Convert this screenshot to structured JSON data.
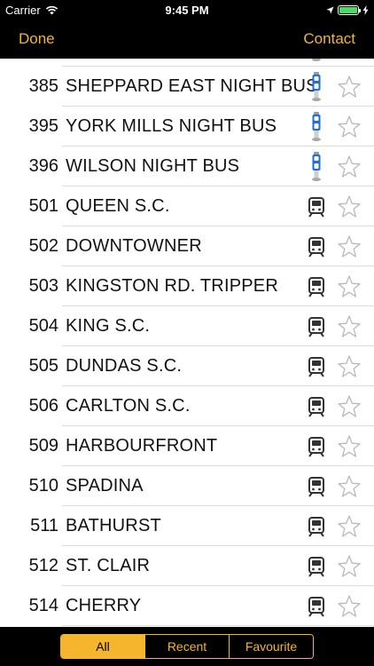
{
  "status_bar": {
    "carrier": "Carrier",
    "time": "9:45 PM"
  },
  "nav": {
    "done_label": "Done",
    "contact_label": "Contact"
  },
  "routes": [
    {
      "number": "",
      "name": "",
      "type": "night"
    },
    {
      "number": "385",
      "name": "SHEPPARD EAST NIGHT BUS",
      "type": "night"
    },
    {
      "number": "395",
      "name": "YORK MILLS NIGHT BUS",
      "type": "night"
    },
    {
      "number": "396",
      "name": "WILSON NIGHT BUS",
      "type": "night"
    },
    {
      "number": "501",
      "name": "QUEEN S.C.",
      "type": "streetcar"
    },
    {
      "number": "502",
      "name": "DOWNTOWNER",
      "type": "streetcar"
    },
    {
      "number": "503",
      "name": "KINGSTON RD. TRIPPER",
      "type": "streetcar"
    },
    {
      "number": "504",
      "name": "KING S.C.",
      "type": "streetcar"
    },
    {
      "number": "505",
      "name": "DUNDAS S.C.",
      "type": "streetcar"
    },
    {
      "number": "506",
      "name": "CARLTON S.C.",
      "type": "streetcar"
    },
    {
      "number": "509",
      "name": "HARBOURFRONT",
      "type": "streetcar"
    },
    {
      "number": "510",
      "name": "SPADINA",
      "type": "streetcar"
    },
    {
      "number": "511",
      "name": "BATHURST",
      "type": "streetcar"
    },
    {
      "number": "512",
      "name": "ST. CLAIR",
      "type": "streetcar"
    },
    {
      "number": "514",
      "name": "CHERRY",
      "type": "streetcar"
    }
  ],
  "tabs": [
    {
      "label": "All",
      "active": true
    },
    {
      "label": "Recent",
      "active": false
    },
    {
      "label": "Favourite",
      "active": false
    }
  ],
  "colors": {
    "accent": "#f5b52d",
    "background": "#000000",
    "night_blue": "#1f6fd6"
  }
}
